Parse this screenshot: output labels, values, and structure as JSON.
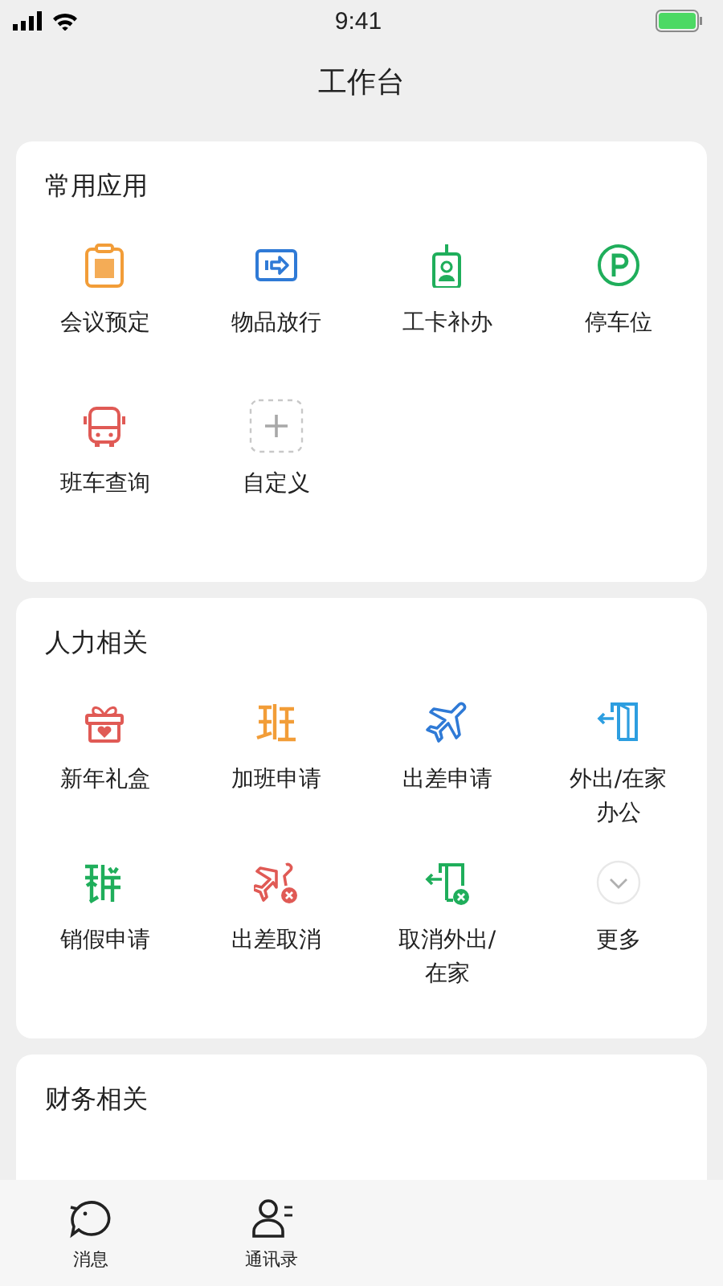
{
  "status_bar": {
    "time": "9:41"
  },
  "header": {
    "title": "工作台"
  },
  "sections": [
    {
      "title": "常用应用",
      "items": [
        {
          "label": "会议预定"
        },
        {
          "label": "物品放行"
        },
        {
          "label": "工卡补办"
        },
        {
          "label": "停车位"
        },
        {
          "label": "班车查询"
        },
        {
          "label": "自定义"
        }
      ]
    },
    {
      "title": "人力相关",
      "items": [
        {
          "label": "新年礼盒"
        },
        {
          "label": "加班申请"
        },
        {
          "label": "出差申请"
        },
        {
          "label": "外出/在家办公"
        },
        {
          "label": "销假申请"
        },
        {
          "label": "出差取消"
        },
        {
          "label": "取消外出/在家"
        },
        {
          "label": "更多"
        }
      ]
    },
    {
      "title": "财务相关"
    }
  ],
  "tab_bar": [
    {
      "label": "消息"
    },
    {
      "label": "通讯录"
    }
  ]
}
